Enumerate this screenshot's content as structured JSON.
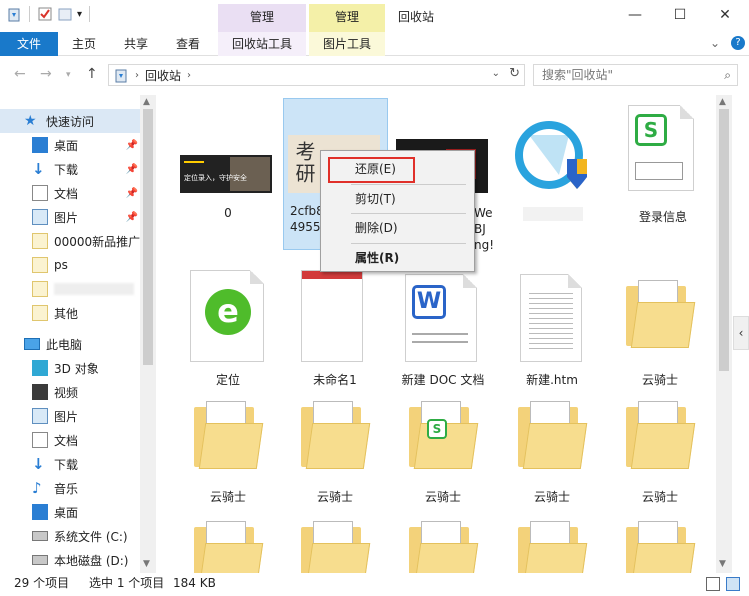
{
  "titlebar": {
    "title": "回收站",
    "ctx_group_pink": "管理",
    "ctx_group_yellow": "管理",
    "minimize": "—",
    "maximize": "☐",
    "close": "✕"
  },
  "tabs": {
    "file": "文件",
    "home": "主页",
    "share": "共享",
    "view": "查看",
    "recycle_tools": "回收站工具",
    "picture_tools": "图片工具",
    "expand": "⌄",
    "help": "?"
  },
  "address": {
    "path": "回收站",
    "search_placeholder": "搜索\"回收站\""
  },
  "sidebar": {
    "items": [
      {
        "label": "快速访问",
        "icon": "star-icon"
      },
      {
        "label": "桌面",
        "icon": "desktop-icon",
        "pinned": true
      },
      {
        "label": "下载",
        "icon": "download-icon",
        "pinned": true
      },
      {
        "label": "文档",
        "icon": "document-icon",
        "pinned": true
      },
      {
        "label": "图片",
        "icon": "picture-icon",
        "pinned": true
      },
      {
        "label": "00000新品推广",
        "icon": "folder-icon"
      },
      {
        "label": "ps",
        "icon": "folder-icon"
      },
      {
        "label": "",
        "icon": "folder-icon"
      },
      {
        "label": "其他",
        "icon": "folder-icon"
      },
      {
        "label": "此电脑",
        "icon": "pc-icon"
      },
      {
        "label": "3D 对象",
        "icon": "3d-objects-icon"
      },
      {
        "label": "视频",
        "icon": "video-icon"
      },
      {
        "label": "图片",
        "icon": "picture-icon"
      },
      {
        "label": "文档",
        "icon": "document-icon"
      },
      {
        "label": "下载",
        "icon": "download-icon"
      },
      {
        "label": "音乐",
        "icon": "music-icon"
      },
      {
        "label": "桌面",
        "icon": "desktop-icon"
      },
      {
        "label": "系统文件 (C:)",
        "icon": "drive-icon"
      },
      {
        "label": "本地磁盘 (D:)",
        "icon": "drive-icon"
      }
    ]
  },
  "files": {
    "row1": [
      {
        "name": "0"
      },
      {
        "name": "2cfb8\n4955a"
      },
      {
        "name": "We\nBJ\nng!"
      },
      {
        "name": ""
      },
      {
        "name": "登录信息"
      }
    ],
    "row2": [
      {
        "name": "定位"
      },
      {
        "name": "未命名1"
      },
      {
        "name": "新建 DOC 文档"
      },
      {
        "name": "新建.htm"
      },
      {
        "name": "云骑士"
      }
    ],
    "row3": [
      {
        "name": "云骑士"
      },
      {
        "name": "云骑士"
      },
      {
        "name": "云骑士"
      },
      {
        "name": "云骑士"
      },
      {
        "name": "云骑士"
      }
    ],
    "thumb0_text": "定位录入，守护安全",
    "thumb1_text": "考研"
  },
  "context_menu": {
    "restore": "还原(E)",
    "cut": "剪切(T)",
    "delete": "删除(D)",
    "properties": "属性(R)"
  },
  "status": {
    "count": "29 个项目",
    "selected": "选中 1 个项目",
    "size": "184 KB"
  },
  "colors": {
    "file_tab": "#1979ca",
    "selection": "#cce4f7",
    "highlight": "#e0302a"
  }
}
